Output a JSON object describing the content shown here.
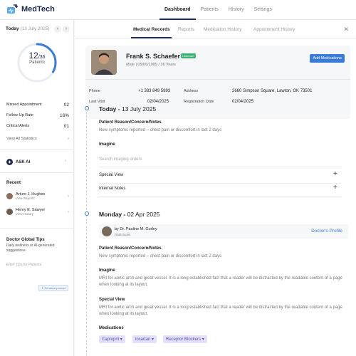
{
  "app": {
    "name": "MedTech"
  },
  "nav": [
    "Dashboard",
    "Patients",
    "History",
    "Settings"
  ],
  "sidebar": {
    "today_label": "Today",
    "today_date": "(13 July 2025)",
    "gauge": {
      "count": "12",
      "total": "/36",
      "label": "Patients",
      "fraction": 0.333
    },
    "stats": [
      {
        "label": "Missed Appointment",
        "value": "02"
      },
      {
        "label": "Follow-Up Rate",
        "value": "16%"
      },
      {
        "label": "Critical Alerts",
        "value": "01"
      }
    ],
    "view_all": "View All Statistics",
    "ask_ai": "ASK AI",
    "recent_title": "Recent",
    "recent": [
      {
        "name": "Arturo J. Hughes",
        "sub": "View Reports"
      },
      {
        "name": "Henry E. Sawyer",
        "sub": "View History"
      }
    ],
    "tips_title": "Doctor Global Tips",
    "tips_desc": "Daily wellness or AI-generated suggestions",
    "tips_placeholder": "Enter Tips for Patients",
    "enhance": "Enhance prompt"
  },
  "tabs": [
    "Medical Records",
    "Reports",
    "Medication History",
    "Appointment History"
  ],
  "patient": {
    "name": "Frank S. Schaefer",
    "badge": "Unknown",
    "meta": "Male  |  05/06/1989  /  36 Years",
    "add_button": "Add Medications",
    "phone_label": "Phone",
    "phone": "+1 383 849 5893",
    "address_label": "Address",
    "address": "2660 Simpson Square, Lawton, OK 73501",
    "last_visit_label": "Last Visit",
    "last_visit": "02/04/2025",
    "registration_label": "Registration Date",
    "registration": "02/04/2025"
  },
  "records": {
    "today": {
      "day": "Today -",
      "date": "13 July 2025",
      "reason_title": "Patient Reason/Concern/Notes",
      "reason_text": "New symptoms reported – chest pain or discomfort in last 2 days",
      "imagine_title": "Imagine",
      "imagine_placeholder": "Search imaging orders",
      "special_view": "Special View",
      "internal_notes": "Internal Notes"
    },
    "monday": {
      "day": "Monday -",
      "date": "02 Apr 2025",
      "doctor": "by Dr. Pauline M. Gurley",
      "doctor_role": "Radiologist",
      "doctor_link": "Doctor's Profile",
      "reason_title": "Patient Reason/Concern/Notes",
      "reason_text": "New symptoms reported – chest pain or discomfort in last 2 days",
      "imagine_title": "Imagine",
      "imagine_text": "MRI for aortic arch and great vessel. It is a long established fact that a reader will be distracted by the readable content of a page when looking at its layout.",
      "special_title": "Special View",
      "special_text": "MRI for aortic arch and great vessel. It is a long established fact that a reader will be distracted by the readable content of a page when looking at its layout.",
      "medications_title": "Medications",
      "medications": [
        "Captopril",
        "losartan",
        "Receptor Blockers"
      ]
    }
  },
  "colors": {
    "accent": "#3a7bd5",
    "navy": "#1d2b4f",
    "chip_bg": "#e3e0fb"
  }
}
